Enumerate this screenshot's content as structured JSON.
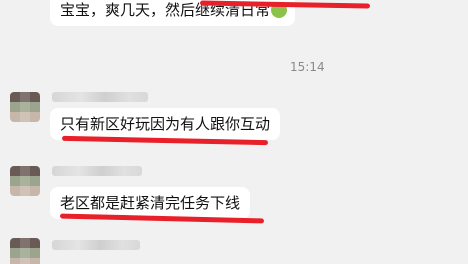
{
  "messages": [
    {
      "sender": "self",
      "text": "宝宝，爽几天，然后继续清日常"
    },
    {
      "sender": "other",
      "text": "只有新区好玩因为有人跟你互动"
    },
    {
      "sender": "other",
      "text": "老区都是赶紧清完任务下线"
    }
  ],
  "timestamp": "15:14",
  "colors": {
    "background": "#f1f1f1",
    "bubble": "#ffffff",
    "annotation": "#e8202a"
  },
  "emoji": "smile-emoji"
}
